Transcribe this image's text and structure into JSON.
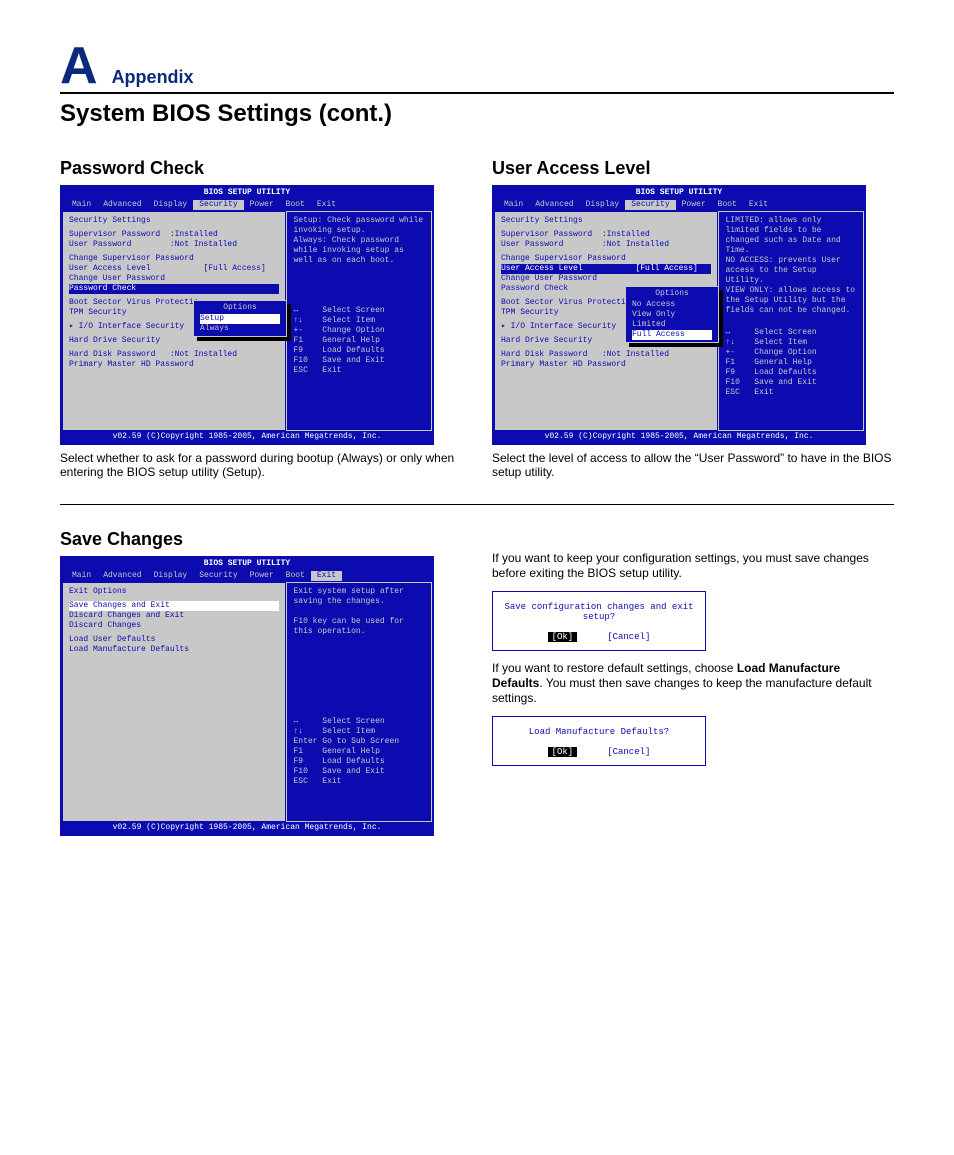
{
  "header": {
    "letter": "A",
    "appendix": "Appendix"
  },
  "page_title": "System BIOS Settings (cont.)",
  "bios_common": {
    "title": "BIOS SETUP UTILITY",
    "menus": [
      "Main",
      "Advanced",
      "Display",
      "Security",
      "Power",
      "Boot",
      "Exit"
    ],
    "footer": "v02.59 (C)Copyright 1985-2005, American Megatrends, Inc.",
    "nav": {
      "l0": "↔     Select Screen",
      "l1": "↑↓    Select Item",
      "l2": "+-    Change Option",
      "l2b": "Enter Go to Sub Screen",
      "l3": "F1    General Help",
      "l4": "F9    Load Defaults",
      "l5": "F10   Save and Exit",
      "l6": "ESC   Exit"
    }
  },
  "sec_left": {
    "heading": "Security Settings",
    "r1": "Supervisor Password  :Installed",
    "r2": "User Password        :Not Installed",
    "r3": "Change Supervisor Password",
    "r4": "User Access Level           [Full Access]",
    "r5": "Change User Password",
    "r6": "Password Check",
    "r7": "Boot Sector Virus Protectio",
    "r8": "TPM Security",
    "r9": "▸ I/O Interface Security",
    "r10": "Hard Drive Security",
    "r11": "Hard Disk Password   :Not Installed",
    "r12": "Primary Master HD Password"
  },
  "password_check": {
    "title": "Password Check",
    "help": "Setup: Check password while invoking setup.\nAlways: Check password while invoking setup as well as on each boot.",
    "popup": {
      "title": "Options",
      "o1": "Setup",
      "o2": "Always"
    },
    "caption": "Select whether to ask for a password during bootup (Always) or only when entering the BIOS setup utility (Setup)."
  },
  "user_access": {
    "title": "User Access Level",
    "help": "LIMITED: allows only limited fields to be changed such as Date and Time.\nNO ACCESS: prevents User access to the Setup Utility.\nVIEW ONLY: allows access to the Setup Utility but the fields can not be changed.",
    "popup": {
      "title": "Options",
      "o1": "No Access",
      "o2": "View Only",
      "o3": "Limited",
      "o4": "Full Access"
    },
    "caption": "Select the level of access to allow the “User Password” to have in the BIOS setup utility."
  },
  "save_changes": {
    "title": "Save Changes",
    "exit_heading": "Exit Options",
    "r1": "Save Changes and Exit",
    "r2": "Discard Changes and Exit",
    "r3": "Discard Changes",
    "r4": "Load User Defaults",
    "r5": "Load Manufacture Defaults",
    "help": "Exit system setup after saving the changes.\n\nF10 key can be used for this operation.",
    "para1_a": "If you want to keep your configuration settings, you must save changes before exiting the BIOS setup utility.",
    "para2_a": "If you want to restore default settings, choose ",
    "para2_b": "Load Manufacture Defaults",
    "para2_c": ". You must then save changes to keep the manufacture default settings.",
    "dlg1": {
      "msg": "Save configuration changes and exit setup?",
      "ok": "[Ok]",
      "cancel": "[Cancel]"
    },
    "dlg2": {
      "msg": "Load Manufacture Defaults?",
      "ok": "[Ok]",
      "cancel": "[Cancel]"
    }
  }
}
